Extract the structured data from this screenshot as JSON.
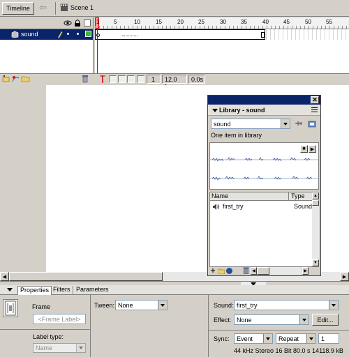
{
  "timeline": {
    "tab_label": "Timeline",
    "scene_label": "Scene 1",
    "ruler_numbers": [
      "1",
      "5",
      "10",
      "15",
      "20",
      "25",
      "30",
      "35",
      "40",
      "45",
      "50",
      "55"
    ],
    "layer_name": "sound",
    "status": {
      "frame": "1",
      "fps": "12.0 fps",
      "time": "0.0s"
    }
  },
  "library": {
    "title": "Library - sound",
    "selector": "sound",
    "count_text": "One item in library",
    "columns": {
      "name": "Name",
      "type": "Type"
    },
    "items": [
      {
        "name": "first_try",
        "type": "Sound"
      }
    ]
  },
  "properties": {
    "tabs": [
      "Properties",
      "Filters",
      "Parameters"
    ],
    "frame_label": "Frame",
    "frame_label_placeholder": "<Frame Label>",
    "label_type_label": "Label type:",
    "label_type_value": "Name",
    "tween_label": "Tween:",
    "tween_value": "None",
    "sound_label": "Sound:",
    "sound_value": "first_try",
    "effect_label": "Effect:",
    "effect_value": "None",
    "edit_button": "Edit...",
    "sync_label": "Sync:",
    "sync_value": "Event",
    "repeat_value": "Repeat",
    "repeat_count": "1",
    "sound_info": "44 kHz Stereo 16 Bit 80.0 s 14118.9 kB"
  },
  "colors": {
    "accent": "#0a246a",
    "playhead": "#cc0000",
    "title_bar": "#0a246a"
  }
}
